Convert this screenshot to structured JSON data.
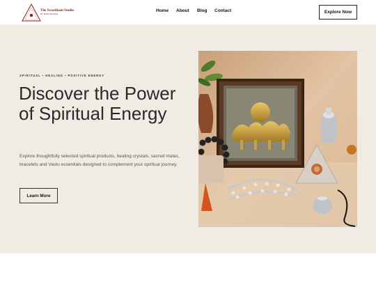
{
  "header": {
    "logo": {
      "title": "The Swastikam Studio",
      "subtitle": "By Ritika Mayekar"
    },
    "nav": [
      {
        "label": "Home"
      },
      {
        "label": "About"
      },
      {
        "label": "Blog"
      },
      {
        "label": "Contact"
      }
    ],
    "cta_label": "Explore Now"
  },
  "hero": {
    "eyebrow": "SPIRITUAL • HEALING • POSITIVE ENERGY",
    "headline": "Discover the Power of Spiritual Energy",
    "description": "Explore thoughtfully selected spiritual products, healing crystals, sacred malas, bracelets and Vastu essentials designed to complement your spiritual journey.",
    "button_label": "Learn More"
  },
  "colors": {
    "hero_background": "#f0ece3",
    "brand": "#8b1d1d",
    "text": "#2a2a2a"
  }
}
